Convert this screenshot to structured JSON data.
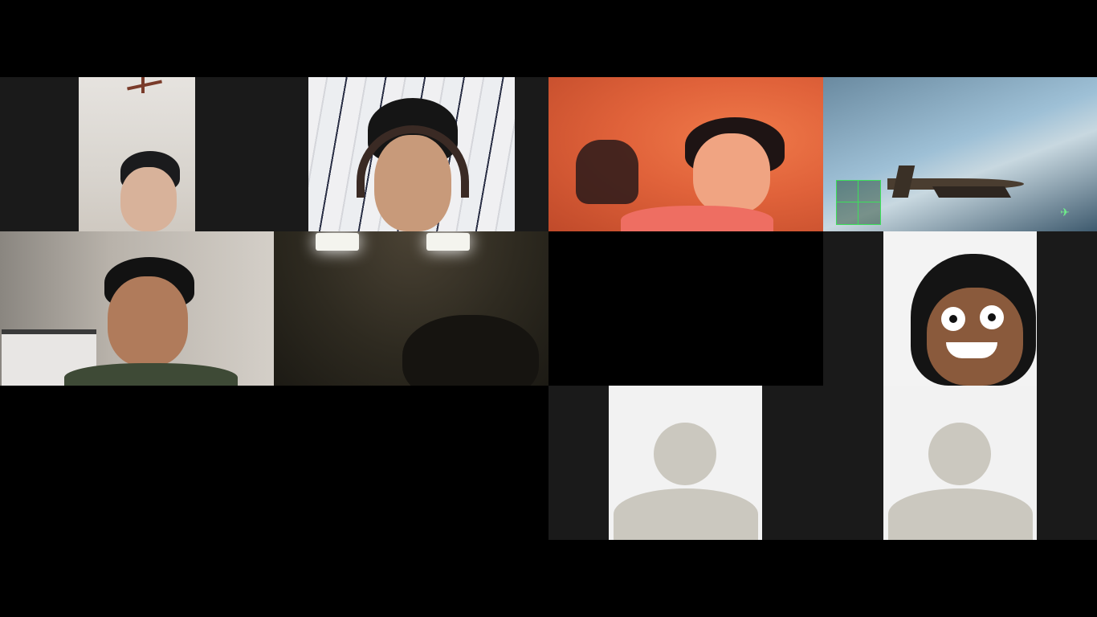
{
  "app": {
    "name": "video-meeting-gallery"
  },
  "colors": {
    "background": "#000000",
    "tile_background": "#1a1a1a",
    "avatar_placeholder_bg": "#f2f2f2",
    "avatar_placeholder_fg": "#cbc8bf"
  },
  "participants": [
    {
      "id": "p1",
      "video": "on",
      "scene": "bedroom-ceiling-fan"
    },
    {
      "id": "p2",
      "video": "on",
      "scene": "headset-wave-wallpaper"
    },
    {
      "id": "p3",
      "video": "on",
      "scene": "orange-lit-room"
    },
    {
      "id": "p4",
      "video": "on",
      "scene": "flight-game-screen-share"
    },
    {
      "id": "p5",
      "video": "on",
      "scene": "room-with-cabinet"
    },
    {
      "id": "p6",
      "video": "on",
      "scene": "dark-room-ceiling-lights"
    },
    {
      "id": "p7",
      "video": "off",
      "scene": "empty-black-tile"
    },
    {
      "id": "p8",
      "video": "on",
      "scene": "doodle-face-overlay"
    },
    {
      "id": "p9",
      "video": "off",
      "scene": "default-avatar-placeholder"
    },
    {
      "id": "p10",
      "video": "off",
      "scene": "default-avatar-placeholder"
    }
  ]
}
